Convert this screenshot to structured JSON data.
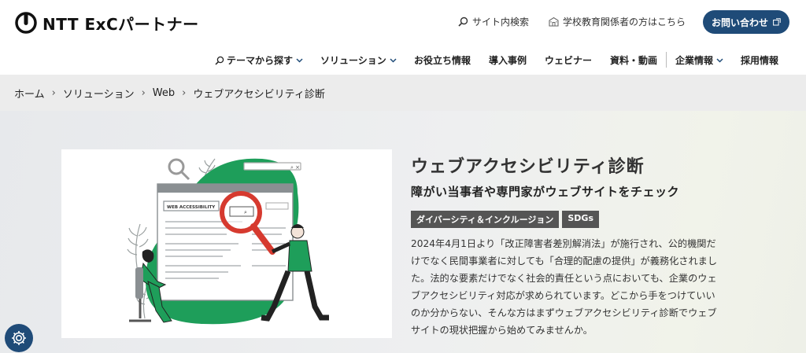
{
  "header": {
    "logo_text": "NTT ExCパートナー",
    "site_search": "サイト内検索",
    "school_link": "学校教育関係者の方はこちら",
    "contact": "お問い合わせ"
  },
  "nav": [
    {
      "label": "テーマから探す",
      "dropdown": true
    },
    {
      "label": "ソリューション",
      "dropdown": true
    },
    {
      "label": "お役立ち情報",
      "dropdown": false
    },
    {
      "label": "導入事例",
      "dropdown": false
    },
    {
      "label": "ウェビナー",
      "dropdown": false
    },
    {
      "label": "資料・動画",
      "dropdown": false
    },
    {
      "label": "企業情報",
      "dropdown": true
    },
    {
      "label": "採用情報",
      "dropdown": false
    }
  ],
  "breadcrumb": [
    "ホーム",
    "ソリューション",
    "Web",
    "ウェブアクセシビリティ診断"
  ],
  "hero": {
    "title": "ウェブアクセシビリティ診断",
    "subtitle": "障がい当事者や専門家がウェブサイトをチェック",
    "tags": [
      "ダイバーシティ＆インクルージョン",
      "SDGs"
    ],
    "description_lines": [
      "2024年4月1日より「改正障害者差別解消法」が施行され、公的機関だ",
      "けでなく民間事業者に対しても「合理的配慮の提供」が義務化されまし",
      "た。法的な要素だけでなく社会的責任という点においても、企業のウェ",
      "ブアクセシビリティ対応が求められています。どこから手をつけていい",
      "のか分からない、そんな方はまずウェブアクセシビリティ診断でウェブ",
      "サイトの現状把握から始めてみませんか。"
    ],
    "illustration_label": "WEB ACCESSIBILITY"
  },
  "colors": {
    "brand_navy": "#1f4b78",
    "accent_green": "#1e9e5a",
    "magnifier_red": "#d63a2f",
    "tag_gray": "#555555"
  },
  "icons": [
    "search-icon",
    "school-icon",
    "external-link-icon",
    "chevron-down-icon",
    "accessibility-gear-icon"
  ]
}
